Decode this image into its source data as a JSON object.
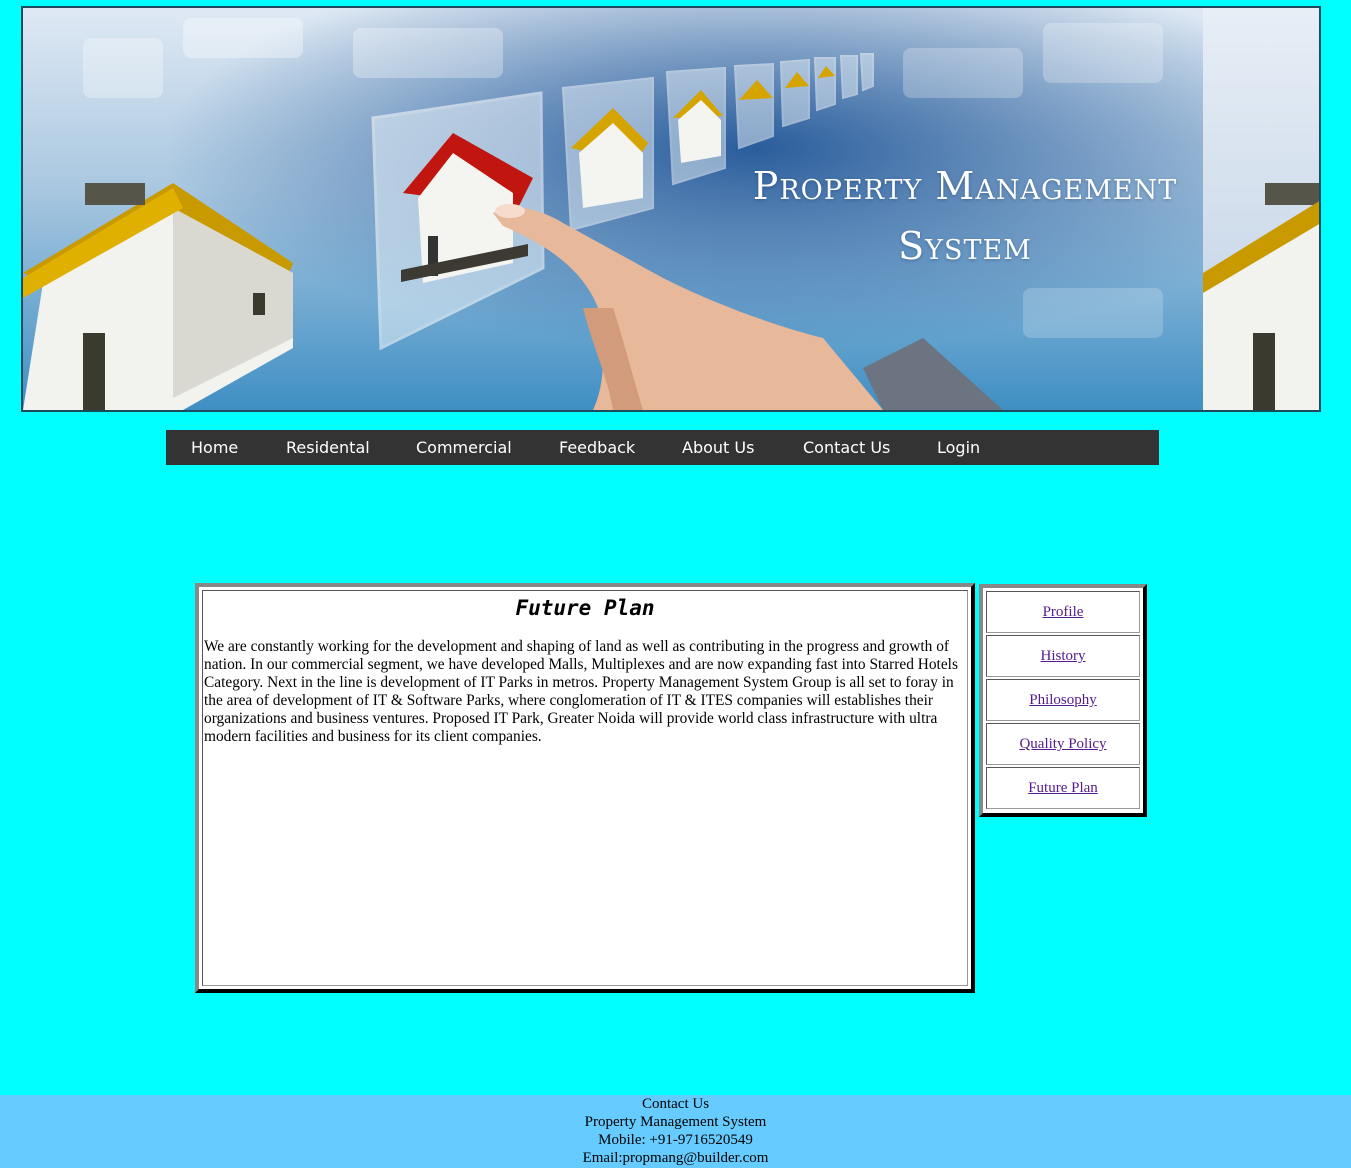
{
  "banner": {
    "title_line1": "Property Management",
    "title_line2": "System"
  },
  "nav": {
    "items": [
      {
        "label": "Home"
      },
      {
        "label": "Residental"
      },
      {
        "label": "Commercial"
      },
      {
        "label": "Feedback"
      },
      {
        "label": "About Us"
      },
      {
        "label": "Contact Us"
      },
      {
        "label": "Login"
      }
    ]
  },
  "main": {
    "heading": "Future Plan",
    "body": "We are constantly working for the development and shaping of land as well as contributing in the progress and growth of nation. In our commercial segment, we have developed Malls, Multiplexes and are now expanding fast into Starred Hotels Category. Next in the line is development of IT Parks in metros. Property Management System Group is all set to foray in the area of development of IT & Software Parks, where conglomeration of IT & ITES companies will establishes their organizations and business ventures. Proposed IT Park, Greater Noida will provide world class infrastructure with ultra modern facilities and business for its client companies."
  },
  "sidebar": {
    "links": [
      {
        "label": "Profile"
      },
      {
        "label": "History"
      },
      {
        "label": "Philosophy"
      },
      {
        "label": "Quality Policy"
      },
      {
        "label": "Future Plan"
      }
    ]
  },
  "footer": {
    "line1": "Contact Us",
    "line2": "Property Management System",
    "line3": "Mobile: +91-9716520549",
    "line4": "Email:propmang@builder.com"
  },
  "colors": {
    "page_background": "#00ffff",
    "nav_background": "#333333",
    "footer_background": "#66ccff",
    "link_visited": "#551a8b",
    "roof_red": "#c0160f",
    "roof_yellow": "#d6a400"
  }
}
